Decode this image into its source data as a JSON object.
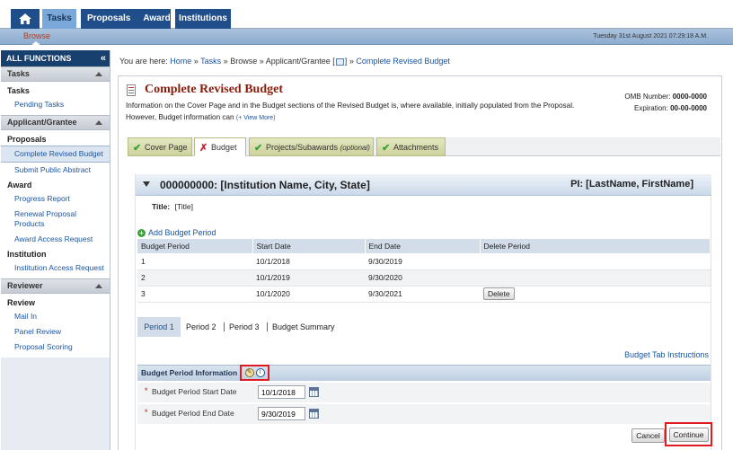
{
  "topnav": {
    "tabs": {
      "tasks": "Tasks",
      "proposals": "Proposals",
      "awards": "Awards",
      "institutions": "Institutions"
    },
    "browse": "Browse",
    "datetime": "Tuesday 31st August 2021 07:29:18 A.M."
  },
  "sidebar": {
    "title": "ALL FUNCTIONS",
    "collapse_glyph": "«",
    "groups": [
      {
        "header": "Tasks",
        "sections": [
          {
            "title": "Tasks",
            "items": [
              "Pending Tasks"
            ]
          }
        ]
      },
      {
        "header": "Applicant/Grantee",
        "sections": [
          {
            "title": "Proposals",
            "items": [
              "Complete Revised Budget",
              "Submit Public Abstract"
            ]
          },
          {
            "title": "Award",
            "items": [
              "Progress Report",
              "Renewal Proposal Products",
              "Award Access Request"
            ]
          },
          {
            "title": "Institution",
            "items": [
              "Institution Access Request"
            ]
          }
        ]
      },
      {
        "header": "Reviewer",
        "sections": [
          {
            "title": "Review",
            "items": [
              "Mail In",
              "Panel Review",
              "Proposal Scoring"
            ]
          }
        ]
      }
    ]
  },
  "breadcrumb": {
    "prefix": "You are here:",
    "home": "Home",
    "tasks": "Tasks",
    "browse": "Browse",
    "applicant": "Applicant/Grantee [",
    "bracket_close": "]",
    "current": "Complete Revised Budget",
    "sep": "»"
  },
  "page": {
    "title": "Complete Revised Budget",
    "description": "Information on the Cover Page and in the Budget sections of the Revised Budget is, where available, initially populated from the Proposal. However, Budget information can",
    "view_more": "(+ View More)",
    "omb_label": "OMB Number:",
    "omb_value": "0000-0000",
    "exp_label": "Expiration:",
    "exp_value": "00-00-0000"
  },
  "tabs": {
    "cover": "Cover Page",
    "budget": "Budget",
    "projects": "Projects/Subawards",
    "projects_note": "(optional)",
    "attachments": "Attachments"
  },
  "institution": {
    "name": "000000000: [Institution Name, City, State]",
    "pi": "PI: [LastName, FirstName]",
    "title_label": "Title:",
    "title_value": "[Title]"
  },
  "budget": {
    "add_period": "Add Budget Period",
    "columns": [
      "Budget Period",
      "Start Date",
      "End Date",
      "Delete Period"
    ],
    "rows": [
      {
        "period": "1",
        "start": "10/1/2018",
        "end": "9/30/2019",
        "delete": ""
      },
      {
        "period": "2",
        "start": "10/1/2019",
        "end": "9/30/2020",
        "delete": ""
      },
      {
        "period": "3",
        "start": "10/1/2020",
        "end": "9/30/2021",
        "delete": "Delete"
      }
    ]
  },
  "period_tabs": {
    "p1": "Period 1",
    "p2": "Period 2",
    "p3": "Period 3",
    "summary": "Budget Summary"
  },
  "instructions_link": "Budget Tab Instructions",
  "period_info": {
    "header": "Budget Period Information",
    "start_label": "Budget Period Start Date",
    "start_value": "10/1/2018",
    "end_label": "Budget Period End Date",
    "end_value": "9/30/2019",
    "required": "*"
  },
  "actions": {
    "cancel": "Cancel",
    "continue": "Continue"
  },
  "colors": {
    "nav_blue": "#1f4e8a",
    "title_red": "#8a1c0a",
    "link_blue": "#1a55a0",
    "highlight_red": "#e01b24"
  }
}
